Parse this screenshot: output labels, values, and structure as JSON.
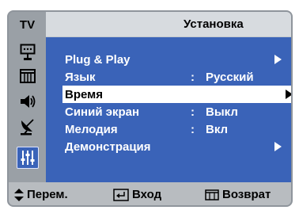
{
  "header": {
    "tv_label": "TV",
    "title": "Установка"
  },
  "sidebar": {
    "icons": [
      "antenna-picture-icon",
      "screen-icon",
      "speaker-icon",
      "satellite-dish-icon",
      "equalizer-sliders-icon"
    ],
    "active_index": 4
  },
  "menu": {
    "items": [
      {
        "label": "Plug & Play",
        "colon": "",
        "value": "",
        "has_arrow": true,
        "selected": false
      },
      {
        "label": "Язык",
        "colon": ":",
        "value": "Русский",
        "has_arrow": false,
        "selected": false
      },
      {
        "label": "Время",
        "colon": "",
        "value": "",
        "has_arrow": true,
        "selected": true
      },
      {
        "label": "Синий экран",
        "colon": ":",
        "value": "Выкл",
        "has_arrow": false,
        "selected": false
      },
      {
        "label": "Мелодия",
        "colon": ":",
        "value": "Вкл",
        "has_arrow": false,
        "selected": false
      },
      {
        "label": "Демонстрация",
        "colon": "",
        "value": "",
        "has_arrow": true,
        "selected": false
      }
    ]
  },
  "footer": {
    "move_label": "Перем.",
    "enter_label": "Вход",
    "return_label": "Возврат"
  },
  "colors": {
    "panel_blue": "#3a63b8",
    "frame_gray": "#9aa0a6",
    "highlight_white": "#ffffff"
  }
}
